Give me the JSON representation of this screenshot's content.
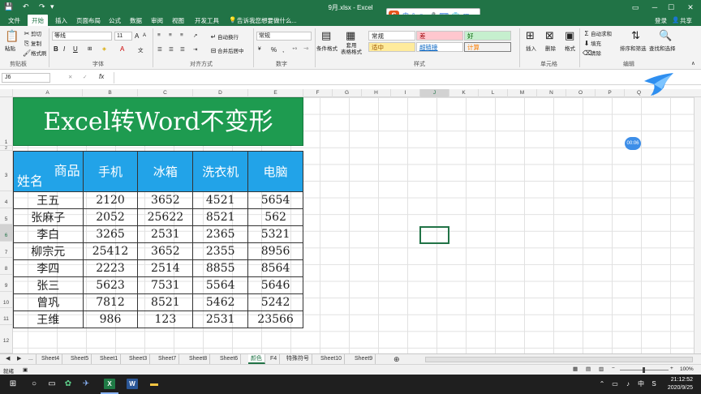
{
  "window": {
    "title": "9月.xlsx - Excel",
    "login": "登录",
    "share": "共享"
  },
  "menu": [
    "文件",
    "开始",
    "插入",
    "页面布局",
    "公式",
    "数据",
    "审阅",
    "视图",
    "开发工具"
  ],
  "menu_active": "开始",
  "tell_me": "告诉我您想要做什么...",
  "ime": {
    "logo": "S",
    "lang": "中"
  },
  "ribbon": {
    "clipboard": {
      "paste": "粘贴",
      "cut": "剪切",
      "copy": "复制",
      "format_painter": "格式刷",
      "group": "剪贴板"
    },
    "font": {
      "name": "等线",
      "size": "11",
      "group": "字体",
      "bold": "B",
      "italic": "I",
      "underline": "U",
      "grow": "A",
      "shrink": "A"
    },
    "align": {
      "wrap": "自动换行",
      "merge": "合并后居中",
      "group": "对齐方式"
    },
    "number": {
      "format": "常规",
      "percent": "%",
      "comma": ",",
      "group": "数字"
    },
    "styles": {
      "cond": "条件格式",
      "table": "套用\n表格格式",
      "normal": "常规",
      "bad": "差",
      "good": "好",
      "neutral": "适中",
      "hyperlink": "超链接",
      "calc": "计算",
      "group": "样式"
    },
    "cells": {
      "insert": "插入",
      "delete": "删除",
      "format": "格式",
      "group": "单元格"
    },
    "editing": {
      "autosum": "自动求和",
      "fill": "填充",
      "clear": "清除",
      "sort": "排序和筛选",
      "find": "查找和选择",
      "group": "编辑"
    }
  },
  "formula": {
    "namebox": "J6",
    "fx": "fx",
    "content": ""
  },
  "columns": [
    "A",
    "B",
    "C",
    "D",
    "E",
    "F",
    "G",
    "H",
    "I",
    "J",
    "K",
    "L",
    "M",
    "N",
    "O",
    "P",
    "Q"
  ],
  "rows": [
    "1",
    "2",
    "3",
    "4",
    "5",
    "6",
    "7",
    "8",
    "9",
    "10",
    "11",
    "12"
  ],
  "sheet": {
    "title": "Excel转Word不变形",
    "corner_top": "商品",
    "corner_bottom": "姓名",
    "headers": [
      "手机",
      "冰箱",
      "洗衣机",
      "电脑"
    ],
    "data": [
      [
        "王五",
        "2120",
        "3652",
        "4521",
        "5654"
      ],
      [
        "张麻子",
        "2052",
        "25622",
        "8521",
        "562"
      ],
      [
        "李白",
        "3265",
        "2531",
        "2365",
        "5321"
      ],
      [
        "柳宗元",
        "25412",
        "3652",
        "2355",
        "8956"
      ],
      [
        "李四",
        "2223",
        "2514",
        "8855",
        "8564"
      ],
      [
        "张三",
        "5623",
        "7531",
        "5564",
        "5646"
      ],
      [
        "曾巩",
        "7812",
        "8521",
        "5462",
        "5242"
      ],
      [
        "王维",
        "986",
        "123",
        "2531",
        "23566"
      ]
    ]
  },
  "timer": "00:06",
  "tabs": [
    "...",
    "Sheet4",
    "Sheet5",
    "Sheet1",
    "Sheet3",
    "Sheet7",
    "Sheet8",
    "Sheet6",
    "颜色",
    "F4",
    "特殊符号",
    "Sheet10",
    "Sheet9"
  ],
  "tab_active": "颜色",
  "status": {
    "ready": "就绪",
    "zoom": "100%"
  },
  "clock": {
    "time": "21:12:52",
    "date": "2020/9/25"
  },
  "taskbar": {
    "ime": "中",
    "excel": "X",
    "word": "W"
  },
  "colors": {
    "ribbon_green": "#217346",
    "title_fill": "#1e9b50",
    "header_fill": "#22a3e8"
  }
}
